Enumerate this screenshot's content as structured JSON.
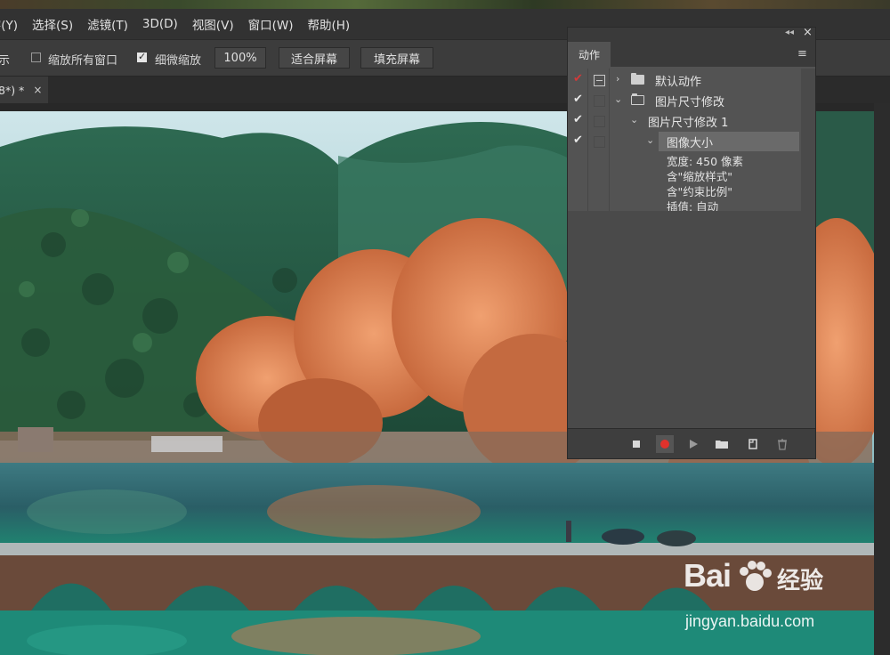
{
  "menubar": {
    "items": [
      "字(Y)",
      "选择(S)",
      "滤镜(T)",
      "3D(D)",
      "视图(V)",
      "窗口(W)",
      "帮助(H)"
    ],
    "first_visible": "字(Y)",
    "item_labels": [
      "选择(S)",
      "滤镜(T)",
      "3D(D)",
      "视图(V)",
      "窗口(W)",
      "帮助(H)"
    ]
  },
  "options": {
    "show_label_partial": "示",
    "zoom_all_windows_label": "缩放所有窗口",
    "zoom_all_windows_checked": false,
    "scrubby_zoom_label": "细微缩放",
    "scrubby_zoom_checked": true,
    "zoom_value": "100%",
    "fit_screen_label": "适合屏幕",
    "fill_screen_label": "填充屏幕"
  },
  "document_tab": {
    "title": "8*) *",
    "close_glyph": "×"
  },
  "actions_panel": {
    "tab_label": "动作",
    "menu_glyph": "≡",
    "collapse_glyph": "◂◂",
    "close_glyph": "×",
    "rows": [
      {
        "label": "默认动作",
        "tick": "✔",
        "tick_red": true,
        "expanded": false
      },
      {
        "label": "图片尺寸修改",
        "tick": "✔",
        "tick_red": false,
        "expanded": true
      },
      {
        "label": "图片尺寸修改 1",
        "tick": "✔",
        "tick_red": false,
        "expanded": true
      },
      {
        "label": "图像大小",
        "tick": "✔",
        "tick_red": false,
        "expanded": true
      }
    ],
    "details": [
      "宽度: 450 像素",
      "含\"缩放样式\"",
      "含\"约束比例\"",
      "插值: 自动"
    ],
    "bottom_buttons": [
      "stop-icon",
      "record-icon",
      "play-icon",
      "folder-icon",
      "new-action-icon",
      "delete-icon"
    ],
    "record_color": "#e0322c"
  },
  "watermark": {
    "logo": "Bai",
    "logo_suffix": "经验",
    "url": "jingyan.baidu.com"
  },
  "colors": {
    "menubar_bg": "#323232",
    "panel_bg": "#535353",
    "accent_red": "#d23a3a"
  }
}
